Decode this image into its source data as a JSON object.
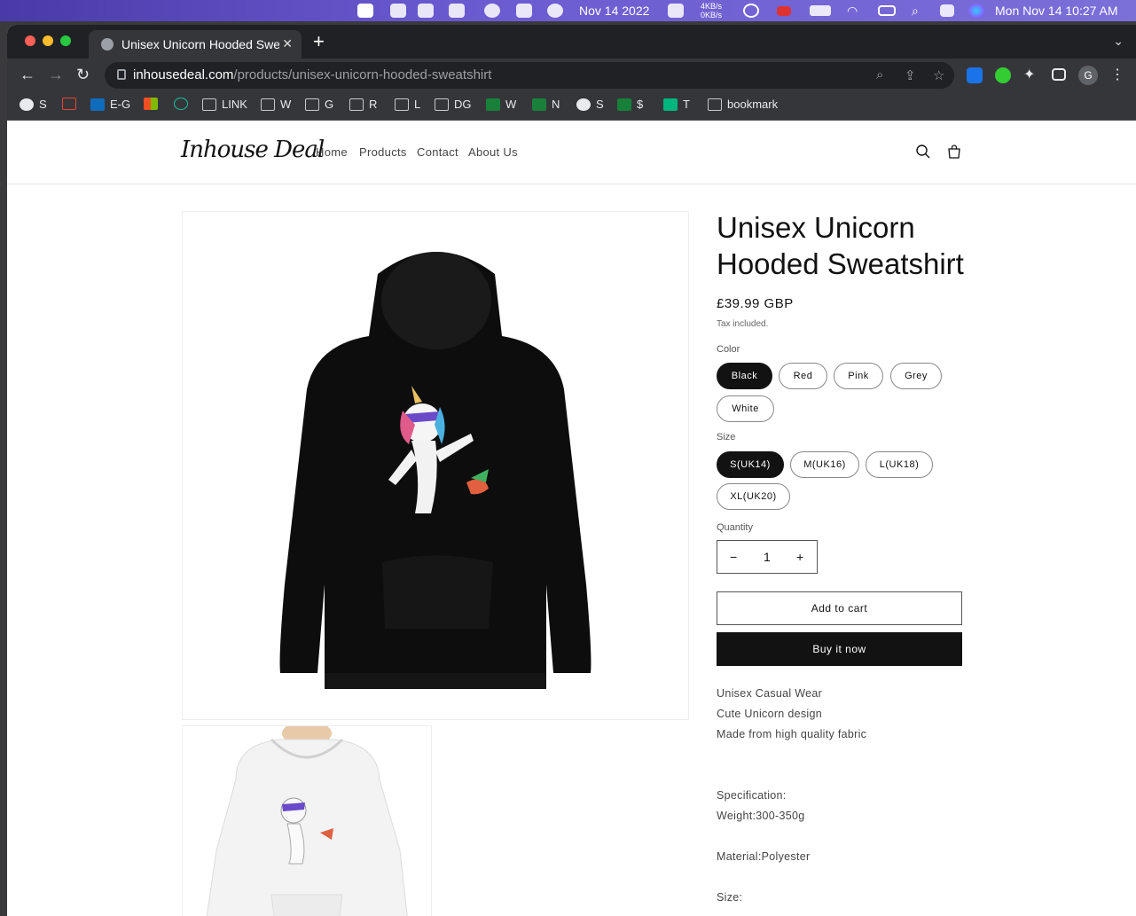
{
  "menubar": {
    "date_label": "Nov 14 2022",
    "net_up": "4KB/s",
    "net_down": "0KB/s",
    "clock": "Mon Nov 14  10:27 AM"
  },
  "browser": {
    "tab_title": "Unisex Unicorn Hooded Sweatshirt",
    "url_domain": "inhousedeal.com",
    "url_path": "/products/unisex-unicorn-hooded-sweatshirt",
    "profile_initial": "G",
    "bookmarks": [
      {
        "label": "S",
        "icon": "globe-icon"
      },
      {
        "label": "",
        "icon": "gmail-icon"
      },
      {
        "label": "E-G",
        "icon": "outlook-icon"
      },
      {
        "label": "",
        "icon": "microsoft-icon"
      },
      {
        "label": "",
        "icon": "grammarly-icon"
      },
      {
        "label": "LINK",
        "icon": "folder-icon"
      },
      {
        "label": "W",
        "icon": "folder-icon"
      },
      {
        "label": "G",
        "icon": "folder-icon"
      },
      {
        "label": "R",
        "icon": "folder-icon"
      },
      {
        "label": "L",
        "icon": "folder-icon"
      },
      {
        "label": "DG",
        "icon": "folder-icon"
      },
      {
        "label": "W",
        "icon": "sheets-icon"
      },
      {
        "label": "N",
        "icon": "sheets-icon"
      },
      {
        "label": "S",
        "icon": "globe-icon"
      },
      {
        "label": "$",
        "icon": "sheets-icon"
      },
      {
        "label": "T",
        "icon": "star-icon"
      },
      {
        "label": "bookmark",
        "icon": "folder-icon"
      }
    ]
  },
  "site": {
    "logo": "Inhouse Deal",
    "nav": [
      "Home",
      "Products",
      "Contact",
      "About Us"
    ]
  },
  "product": {
    "title": "Unisex Unicorn Hooded Sweatshirt",
    "price": "£39.99 GBP",
    "tax_note": "Tax included.",
    "color_label": "Color",
    "colors": [
      "Black",
      "Red",
      "Pink",
      "Grey",
      "White"
    ],
    "selected_color": "Black",
    "size_label": "Size",
    "sizes": [
      "S(UK14)",
      "M(UK16)",
      "L(UK18)",
      "XL(UK20)"
    ],
    "selected_size": "S(UK14)",
    "quantity_label": "Quantity",
    "quantity": "1",
    "add_to_cart": "Add to cart",
    "buy_now": "Buy it now",
    "description": [
      "Unisex Casual Wear",
      "Cute Unicorn design",
      "Made from high quality fabric"
    ],
    "spec_title": "Specification:",
    "weight": "Weight:300-350g",
    "material": "Material:Polyester",
    "size_heading": "Size:"
  },
  "colors": {
    "accent": "#121212",
    "menubar": "#6a5ad0"
  }
}
